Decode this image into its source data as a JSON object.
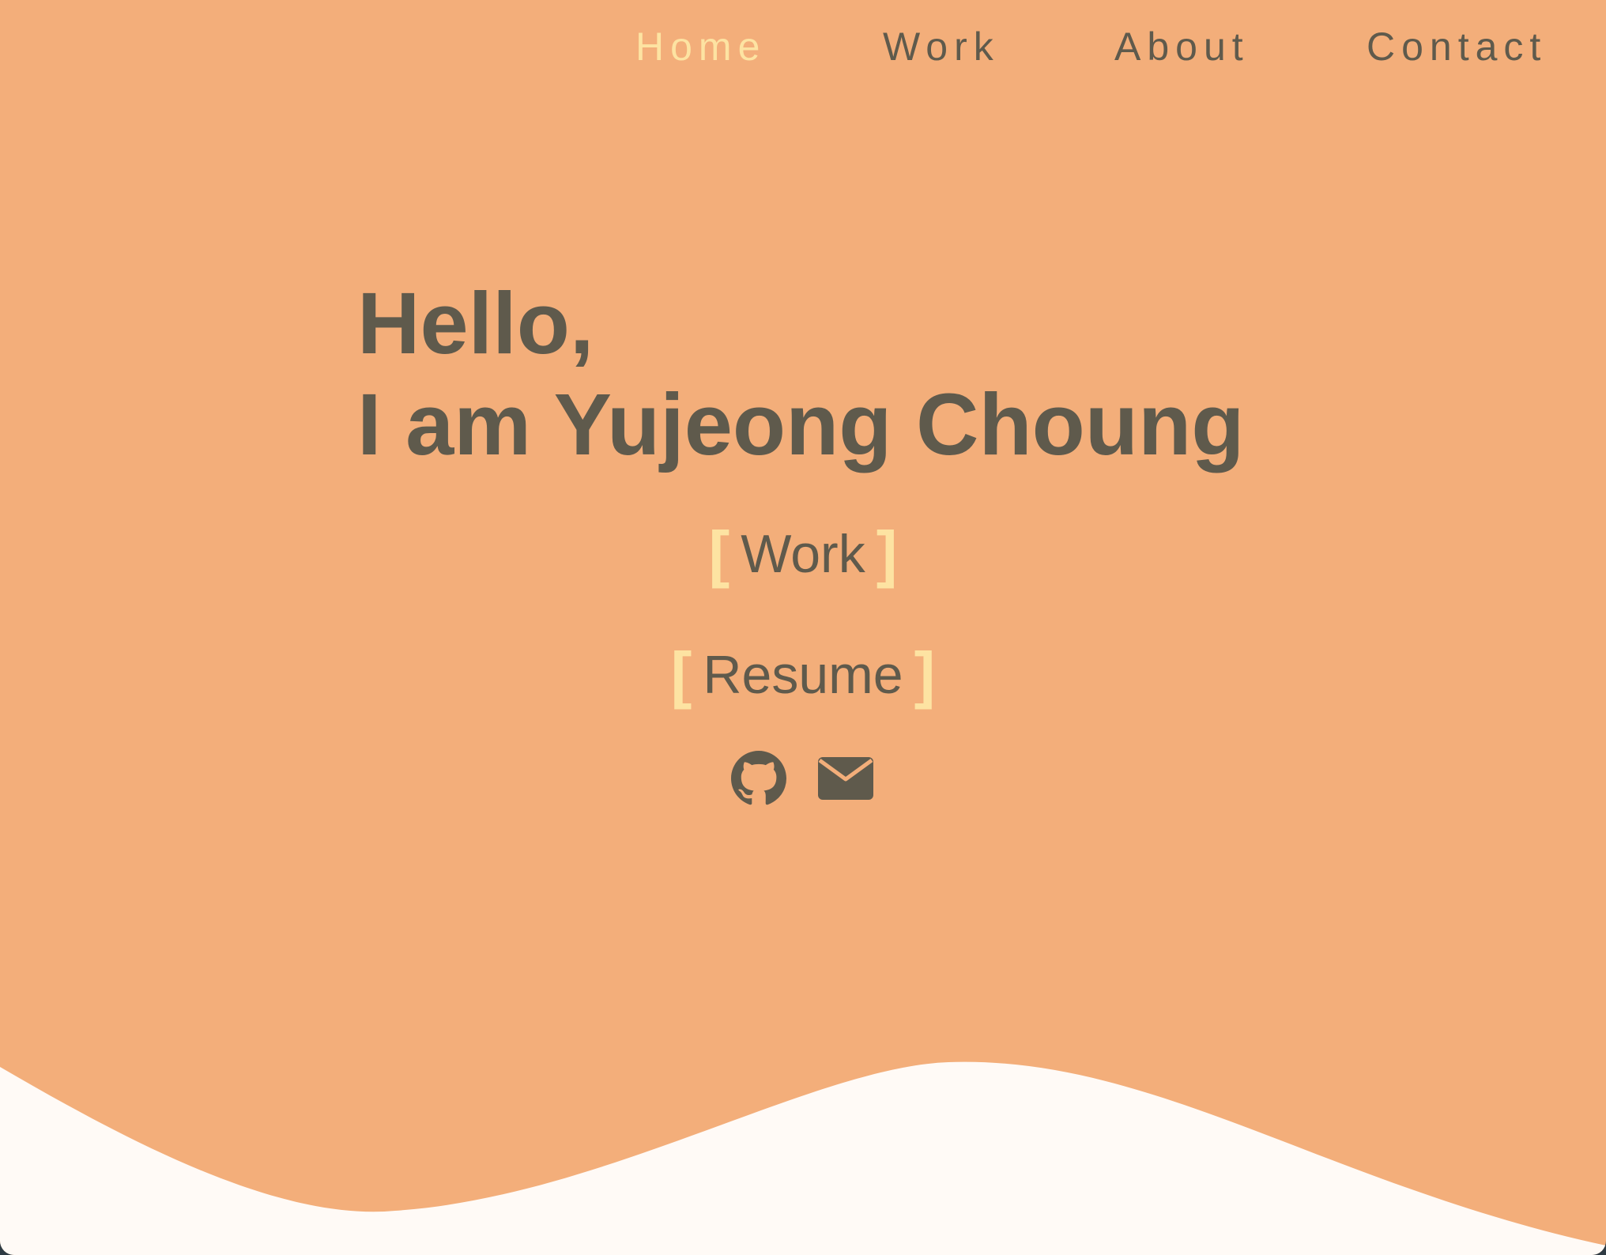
{
  "nav": {
    "items": [
      {
        "label": "Home",
        "active": true
      },
      {
        "label": "Work",
        "active": false
      },
      {
        "label": "About",
        "active": false
      },
      {
        "label": "Contact",
        "active": false
      }
    ]
  },
  "hero": {
    "line1": "Hello,",
    "line2": "I am Yujeong Choung"
  },
  "links": {
    "work_label": "Work",
    "resume_label": "Resume",
    "bracket_open": "[",
    "bracket_close": "]"
  },
  "social": {
    "icons": [
      "github-icon",
      "mail-icon"
    ]
  },
  "colors": {
    "background": "#f3ae7a",
    "text": "#5f5a4c",
    "accent": "#fde3a2",
    "wave": "#fffaf6"
  }
}
